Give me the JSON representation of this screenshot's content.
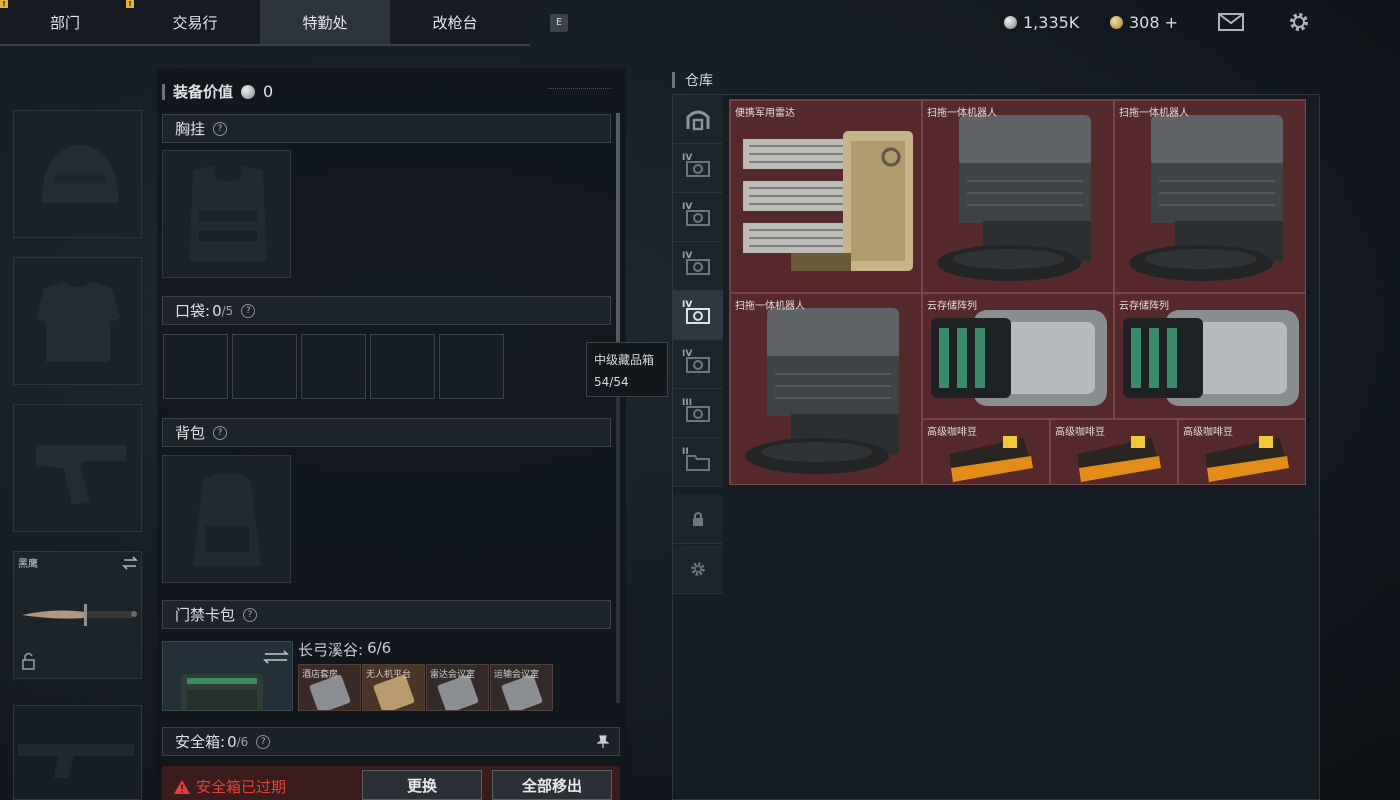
{
  "nav": {
    "tabs": [
      {
        "label": "部门"
      },
      {
        "label": "交易行"
      },
      {
        "label": "特勤处"
      },
      {
        "label": "改枪台"
      }
    ],
    "markers": [
      "!",
      "!"
    ],
    "keyhint": "E"
  },
  "currency": {
    "silver": "1,335K",
    "gold": "308 +"
  },
  "equipment": {
    "knife_name": "黑鹰"
  },
  "loadout": {
    "value_label": "装备价值",
    "value": "0",
    "chest_rig": {
      "label": "胸挂",
      "help": "?"
    },
    "pockets": {
      "label": "口袋:",
      "count": "0",
      "cap": "/5",
      "help": "?"
    },
    "backpack": {
      "label": "背包",
      "help": "?"
    },
    "keycard": {
      "label": "门禁卡包",
      "help": "?",
      "map": "长弓溪谷:",
      "map_count": "6/6",
      "cards": [
        "酒店套房",
        "无人机平台",
        "雷达会议室",
        "运输会议室"
      ]
    },
    "safebox": {
      "label": "安全箱:",
      "count": "0",
      "cap": "/6",
      "help": "?",
      "warning": "安全箱已过期",
      "replace": "更换",
      "remove_all": "全部移出"
    }
  },
  "storage": {
    "title": "仓库",
    "tabs": [
      "IV",
      "IV",
      "IV",
      "IV",
      "IV",
      "III",
      "II"
    ],
    "items": [
      {
        "name": "便携军用雷达"
      },
      {
        "name": "扫拖一体机器人"
      },
      {
        "name": "扫拖一体机器人"
      },
      {
        "name": "扫拖一体机器人"
      },
      {
        "name": "云存储阵列"
      },
      {
        "name": "云存储阵列"
      },
      {
        "name": "高级咖啡豆"
      },
      {
        "name": "高级咖啡豆"
      },
      {
        "name": "高级咖啡豆"
      }
    ]
  },
  "tooltip": {
    "title": "中级藏品箱",
    "capacity": "54/54"
  }
}
